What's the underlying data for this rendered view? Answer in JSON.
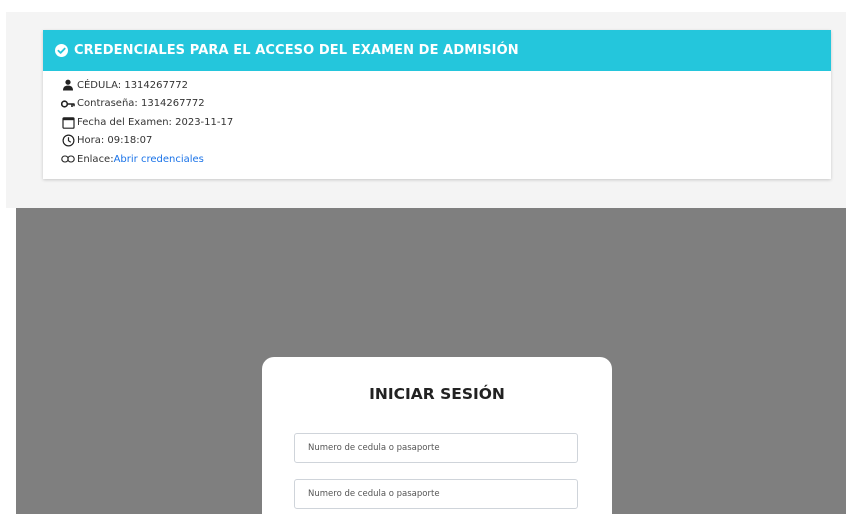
{
  "credentials_card": {
    "title": "CREDENCIALES PARA EL ACCESO DEL EXAMEN DE ADMISIÓN",
    "header_color": "#24c6dc",
    "cedula": "CÉDULA: 1314267772",
    "password": "Contraseña: 1314267772",
    "exam_date": "Fecha del Examen: 2023-11-17",
    "time": "Hora: 09:18:07",
    "link_prefix": "Enlace: ",
    "link_text": "Abrir credenciales",
    "link_color": "#1a73e8"
  },
  "login": {
    "title": "INICIAR SESIÓN",
    "field1_placeholder": "Numero de cedula o pasaporte",
    "field2_placeholder": "Numero de cedula o pasaporte"
  },
  "icons": [
    "check-circle-icon",
    "user-icon",
    "key-icon",
    "calendar-icon",
    "clock-icon",
    "link-icon"
  ]
}
